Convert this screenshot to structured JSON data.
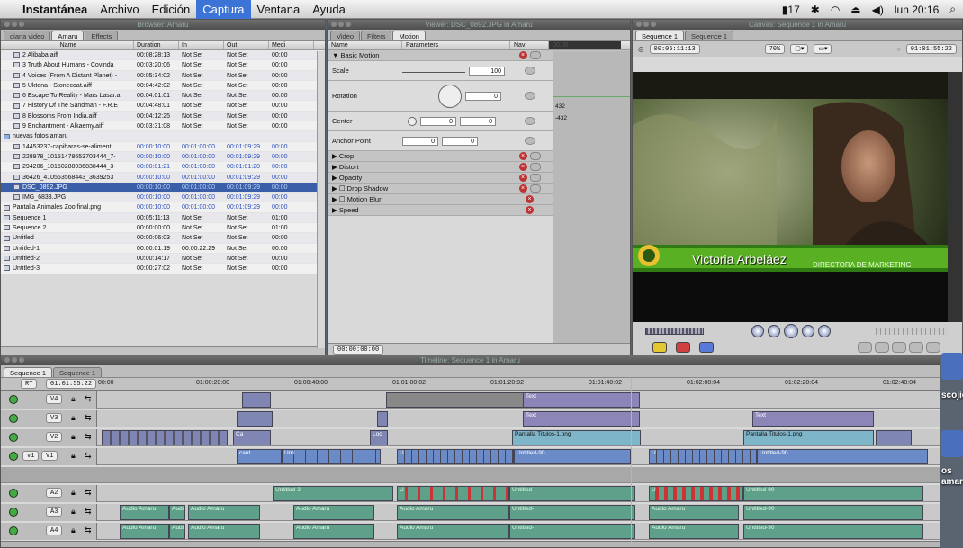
{
  "menubar": {
    "app": "Instantánea",
    "items": [
      "Archivo",
      "Edición",
      "Captura",
      "Ventana",
      "Ayuda"
    ],
    "selected_index": 2,
    "status": {
      "battery": "17",
      "clock": "lun 20:16"
    }
  },
  "browser": {
    "title": "Browser: Amaru",
    "tabs": [
      "diana video",
      "Amaru",
      "Effects"
    ],
    "columns": [
      "Name",
      "Duration",
      "In",
      "Out",
      "Medi"
    ],
    "rows": [
      {
        "name": "2 Alibaba.aiff",
        "duration": "00:08:28:13",
        "in": "Not Set",
        "out": "Not Set",
        "media": "00:00",
        "kind": "audio",
        "indent": 1
      },
      {
        "name": "3 Truth About Humans - Covinda",
        "duration": "00:03:20:06",
        "in": "Not Set",
        "out": "Not Set",
        "media": "00:00",
        "kind": "audio",
        "indent": 1
      },
      {
        "name": "4 Voices (From A Distant Planet) -",
        "duration": "00:05:34:02",
        "in": "Not Set",
        "out": "Not Set",
        "media": "00:00",
        "kind": "audio",
        "indent": 1
      },
      {
        "name": "5 Uktena - Stonecoat.aiff",
        "duration": "00:04:42:02",
        "in": "Not Set",
        "out": "Not Set",
        "media": "00:00",
        "kind": "audio",
        "indent": 1
      },
      {
        "name": "6 Escape To Reality - Mars Lasar.a",
        "duration": "00:04:01:01",
        "in": "Not Set",
        "out": "Not Set",
        "media": "00:00",
        "kind": "audio",
        "indent": 1
      },
      {
        "name": "7 History Of The Sandman - F.R.E",
        "duration": "00:04:48:01",
        "in": "Not Set",
        "out": "Not Set",
        "media": "00:00",
        "kind": "audio",
        "indent": 1
      },
      {
        "name": "8 Blossoms From India.aiff",
        "duration": "00:04:12:25",
        "in": "Not Set",
        "out": "Not Set",
        "media": "00:00",
        "kind": "audio",
        "indent": 1
      },
      {
        "name": "9 Enchantment - Alkaemy.aiff",
        "duration": "00:03:31:08",
        "in": "Not Set",
        "out": "Not Set",
        "media": "00:00",
        "kind": "audio",
        "indent": 1
      },
      {
        "name": "nuevas fotos amaru",
        "duration": "",
        "in": "",
        "out": "",
        "media": "",
        "kind": "folder",
        "indent": 0
      },
      {
        "name": "14453237-capibaras-se-aliment.",
        "duration": "00:00:10:00",
        "in": "00:01:00:00",
        "out": "00:01:09:29",
        "media": "00:00",
        "kind": "still",
        "indent": 1
      },
      {
        "name": "228978_10151478653703444_7-",
        "duration": "00:00:10:00",
        "in": "00:01:00:00",
        "out": "00:01:09:29",
        "media": "00:00",
        "kind": "still",
        "indent": 1
      },
      {
        "name": "294206_10150288936838444_3-",
        "duration": "00:00:01:21",
        "in": "00:01:00:00",
        "out": "00:01:01:20",
        "media": "00:00",
        "kind": "still",
        "indent": 1
      },
      {
        "name": "36426_410553568443_3639253",
        "duration": "00:00:10:00",
        "in": "00:01:00:00",
        "out": "00:01:09:29",
        "media": "00:00",
        "kind": "still",
        "indent": 1
      },
      {
        "name": "DSC_0892.JPG",
        "duration": "00:00:10:00",
        "in": "00:01:00:00",
        "out": "00:01:09:29",
        "media": "00:00",
        "kind": "still",
        "indent": 1,
        "highlight": true
      },
      {
        "name": "IMG_6833.JPG",
        "duration": "00:00:10:00",
        "in": "00:01:00:00",
        "out": "00:01:09:29",
        "media": "00:00",
        "kind": "still",
        "indent": 1
      },
      {
        "name": "Pantalla Animales Zoo final.png",
        "duration": "00:00:10:00",
        "in": "00:01:00:00",
        "out": "00:01:09:29",
        "media": "00:00",
        "kind": "still",
        "indent": 0
      },
      {
        "name": "Sequence 1",
        "duration": "00:05:11:13",
        "in": "Not Set",
        "out": "Not Set",
        "media": "01:00",
        "kind": "seq",
        "indent": 0
      },
      {
        "name": "Sequence 2",
        "duration": "00:00:00:00",
        "in": "Not Set",
        "out": "Not Set",
        "media": "01:00",
        "kind": "seq",
        "indent": 0
      },
      {
        "name": "Untitled",
        "duration": "00:00:06:03",
        "in": "Not Set",
        "out": "Not Set",
        "media": "00:00",
        "kind": "clip",
        "indent": 0
      },
      {
        "name": "Untitled-1",
        "duration": "00:00:01:19",
        "in": "00:00:22:29",
        "out": "Not Set",
        "media": "00:00",
        "kind": "clip",
        "indent": 0
      },
      {
        "name": "Untitled-2",
        "duration": "00:00:14:17",
        "in": "Not Set",
        "out": "Not Set",
        "media": "00:00",
        "kind": "clip",
        "indent": 0
      },
      {
        "name": "Untitled-3",
        "duration": "00:00:27:02",
        "in": "Not Set",
        "out": "Not Set",
        "media": "00:00",
        "kind": "clip",
        "indent": 0
      }
    ]
  },
  "viewer": {
    "title": "Viewer: DSC_0892.JPG in Amaru",
    "tabs": [
      "Video",
      "Filters",
      "Motion"
    ],
    "columns": [
      "Name",
      "Parameters",
      "Nav"
    ],
    "ruler_time": "00:00",
    "timecode": "00:00:00:00",
    "rows": [
      {
        "name": "Basic Motion",
        "group": true,
        "open": true
      },
      {
        "name": "Scale",
        "value": "100"
      },
      {
        "name": "Rotation",
        "value": "0",
        "side_values": [
          "432",
          "-432"
        ]
      },
      {
        "name": "Center",
        "value": "0",
        "value2": "0"
      },
      {
        "name": "Anchor Point",
        "value": "0",
        "value2": "0"
      },
      {
        "name": "Crop",
        "group": true
      },
      {
        "name": "Distort",
        "group": true
      },
      {
        "name": "Opacity",
        "group": true
      },
      {
        "name": "Drop Shadow",
        "group": true,
        "checkbox": true
      },
      {
        "name": "Motion Blur",
        "group": true,
        "checkbox": true
      },
      {
        "name": "Speed",
        "group": true
      }
    ]
  },
  "canvas": {
    "title": "Canvas: Sequence 1 in Amaru",
    "tabs": [
      "Sequence 1",
      "Sequence 1"
    ],
    "timecode": "00:05:11:13",
    "zoom": "70%",
    "duration": "01:01:55:22",
    "lower_third": {
      "name": "Victoria Arbeláez",
      "role": "DIRECTORA DE MARKETING"
    }
  },
  "timeline": {
    "title": "Timeline: Sequence 1 in Amaru",
    "tabs": [
      "Sequence 1",
      "Sequence 1"
    ],
    "current_tc": "01:01:55:22",
    "rt": "RT",
    "ruler": [
      "00:00",
      "01:00:20:00",
      "01:00:40:00",
      "01:01:00:02",
      "01:01:20:02",
      "01:01:40:02",
      "01:02:00:04",
      "01:02:20:04",
      "01:02:40:04"
    ],
    "video_tracks": [
      "V4",
      "V3",
      "V2",
      "V1"
    ],
    "v1_source": "v1",
    "audio_tracks": [
      "A2",
      "A3",
      "A4"
    ],
    "clip_labels": {
      "text": "Text",
      "png": "Pantalla Titulos-1.png",
      "untitled90": "Untitled-90",
      "untitled2": "Untitled-2",
      "audio": "Audio Amaru",
      "audio_short": "Audi",
      "ca": "Ca",
      "caut": "caut",
      "loc": "Loc",
      "untitled_short": "Untitled-",
      "unti": "Unti",
      "untit": "Untit",
      "u": "U",
      "c": "C"
    }
  },
  "desktop": {
    "items": [
      "scojidas",
      "os\namaru"
    ]
  }
}
